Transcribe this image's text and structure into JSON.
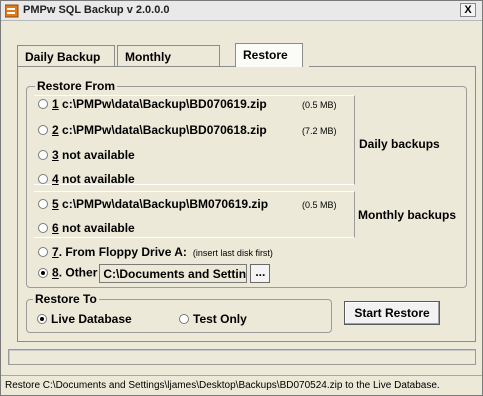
{
  "window": {
    "title": "PMPw SQL Backup  v 2.0.0.0",
    "close_label": "X",
    "app_icon": "database-icon"
  },
  "tabs": [
    {
      "label": "Daily Backup",
      "active": false
    },
    {
      "label": "Monthly Backup",
      "active": false
    },
    {
      "label": "Restore",
      "active": true
    }
  ],
  "restore_from": {
    "legend": "Restore From",
    "options": [
      {
        "num": "1",
        "text": " c:\\PMPw\\data\\Backup\\BD070619.zip",
        "size": "(0.5 MB)",
        "checked": false
      },
      {
        "num": "2",
        "text": " c:\\PMPw\\data\\Backup\\BD070618.zip",
        "size": "(7.2 MB)",
        "checked": false
      },
      {
        "num": "3",
        "text": " not available",
        "size": "",
        "checked": false
      },
      {
        "num": "4",
        "text": " not available",
        "size": "",
        "checked": false
      },
      {
        "num": "5",
        "text": " c:\\PMPw\\data\\Backup\\BM070619.zip",
        "size": "(0.5 MB)",
        "checked": false
      },
      {
        "num": "6",
        "text": " not available",
        "size": "",
        "checked": false
      },
      {
        "num": "7",
        "text": ". From Floppy Drive A:",
        "note": "(insert last disk first)",
        "checked": false
      },
      {
        "num": "8",
        "text": ". Other",
        "checked": true
      }
    ],
    "daily_label": "Daily backups",
    "monthly_label": "Monthly backups",
    "other_path": "C:\\Documents and Settings\\ljam",
    "browse_label": "..."
  },
  "restore_to": {
    "legend": "Restore To",
    "live_label": "Live Database",
    "live_checked": true,
    "test_label": "Test Only",
    "test_checked": false
  },
  "start_button": "Start Restore",
  "progress_fraction": 0,
  "status": "Restore C:\\Documents and Settings\\ljames\\Desktop\\Backups\\BD070524.zip to the Live Database."
}
